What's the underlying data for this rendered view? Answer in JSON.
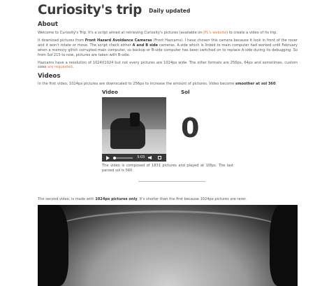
{
  "header": {
    "title": "Curiosity's trip",
    "tagline": "Daily updated"
  },
  "about": {
    "heading": "About",
    "p1": {
      "pre": "Welcome to Curiosity's Trip. It's a script aimed at retrieving Curiosity's pictures (available on ",
      "link": "JPL's website",
      "post": ") to create a video of its trip."
    },
    "p2": {
      "pre": "It download pictures from ",
      "strong1": "Front Hazard Avoidance Cameras",
      "mid1": " (Front Hazcams). I have chosen this camera because it look in front of the rover and it won't rotate or move. The script check either ",
      "strong2": "A and B side",
      "post": " cameras. A-side which is linked to main computer had worked until February when a memory glitch corrupted main computer, so backup or B-side computer has been switched on to replace A-side during its debugging. So from Sol 215 to now, pictures are taken with B-side."
    },
    "p3": {
      "pre": "Hazcams have a resolution of 1024X1024 but not every pictures are 1024px wide. The other formats are 256px, 64px and sometimes, custom sizes ",
      "link": "are requested",
      "post": "."
    }
  },
  "videos": {
    "heading": "Videos",
    "intro": {
      "pre": "In the first video, 1024px pictures are downscaled to 256px to increase the amount of pictures. Video become ",
      "strong": "smoother at sol 360",
      "post": "."
    },
    "col_video_label": "Video",
    "col_sol_label": "Sol",
    "sol_value": "0",
    "player": {
      "time": "3:03"
    },
    "caption": "The video is composed of 1831 pictures and played at 10fps. The last parsed sol is 560",
    "second_intro": {
      "pre": "The second video, is made with ",
      "strong": "1024px pictures only",
      "post": ". It's shorter than the first because 1024px pictures are rarer."
    }
  }
}
